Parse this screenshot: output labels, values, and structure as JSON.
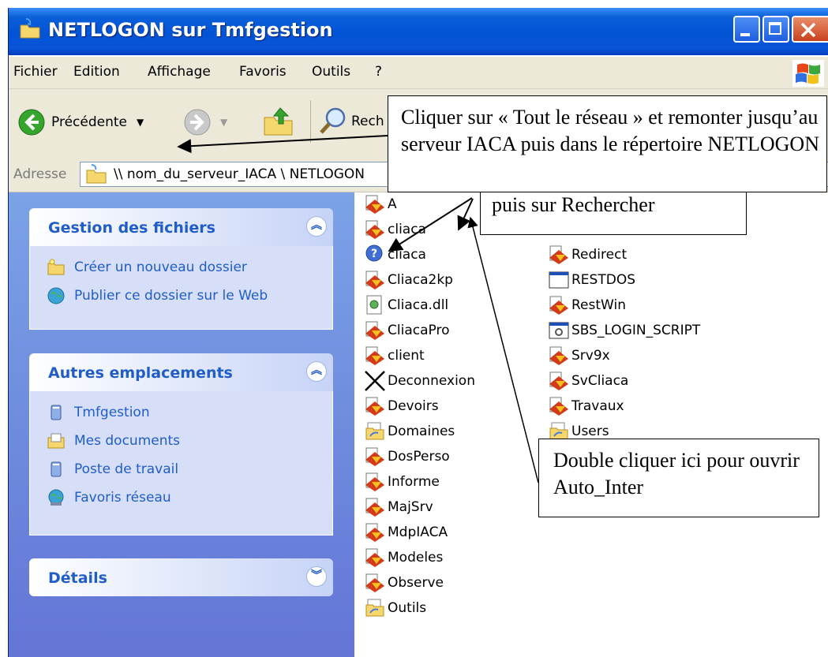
{
  "window": {
    "title": "NETLOGON sur Tmfgestion"
  },
  "menu": [
    "Fichier",
    "Edition",
    "Affichage",
    "Favoris",
    "Outils",
    "?"
  ],
  "toolbar": {
    "back_label": "Précédente",
    "search_label": "Rech"
  },
  "address": {
    "label": "Adresse",
    "value": "\\\\ nom_du_serveur_IACA \\ NETLOGON"
  },
  "tasks": {
    "file": {
      "title": "Gestion des fichiers",
      "items": [
        "Créer un nouveau dossier",
        "Publier ce dossier sur le Web"
      ]
    },
    "places": {
      "title": "Autres emplacements",
      "items": [
        "Tmfgestion",
        "Mes documents",
        "Poste de travail",
        "Favoris réseau"
      ]
    },
    "details": {
      "title": "Détails"
    }
  },
  "files": {
    "col1": [
      {
        "name": "A",
        "icon": "script-icon"
      },
      {
        "name": "cliaca",
        "icon": "script-icon"
      },
      {
        "name": "cliaca",
        "icon": "help-icon"
      },
      {
        "name": "Cliaca2kp",
        "icon": "script-icon"
      },
      {
        "name": "Cliaca.dll",
        "icon": "dll-icon"
      },
      {
        "name": "CliacaPro",
        "icon": "script-icon"
      },
      {
        "name": "client",
        "icon": "script-icon"
      },
      {
        "name": "Deconnexion",
        "icon": "shortcut-x-icon"
      },
      {
        "name": "Devoirs",
        "icon": "script-icon"
      },
      {
        "name": "Domaines",
        "icon": "shared-folder-icon"
      },
      {
        "name": "DosPerso",
        "icon": "script-icon"
      },
      {
        "name": "Informe",
        "icon": "script-icon"
      },
      {
        "name": "MajSrv",
        "icon": "script-icon"
      },
      {
        "name": "MdpIACA",
        "icon": "script-icon"
      },
      {
        "name": "Modeles",
        "icon": "script-icon"
      },
      {
        "name": "Observe",
        "icon": "script-icon"
      },
      {
        "name": "Outils",
        "icon": "shared-folder-icon"
      }
    ],
    "col2": [
      {
        "name": "Redirect",
        "icon": "script-icon"
      },
      {
        "name": "RESTDOS",
        "icon": "window-icon"
      },
      {
        "name": "RestWin",
        "icon": "script-icon"
      },
      {
        "name": "SBS_LOGIN_SCRIPT",
        "icon": "batch-icon"
      },
      {
        "name": "Srv9x",
        "icon": "script-icon"
      },
      {
        "name": "SvCliaca",
        "icon": "script-icon"
      },
      {
        "name": "Travaux",
        "icon": "script-icon"
      },
      {
        "name": "Users",
        "icon": "shared-folder-icon"
      }
    ]
  },
  "callouts": {
    "network": "Cliquer sur « Tout le réseau » et remonter jusqu’au serveur IACA puis dans le répertoire NETLOGON",
    "search": "puis sur Rechercher",
    "double": "Double cliquer ici pour ouvrir Auto_Inter"
  },
  "colors": {
    "title_blue": "#0253d6",
    "task_blue": "#215dc6",
    "pane_bg": "#6f8ee0",
    "panel_bg": "#d6dff7"
  }
}
